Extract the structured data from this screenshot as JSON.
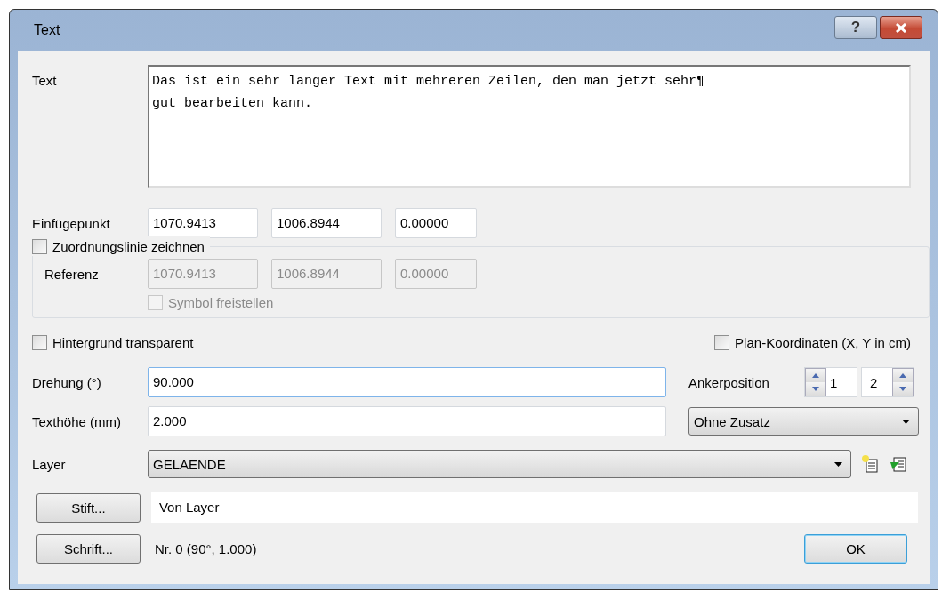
{
  "window": {
    "title": "Text",
    "help_button": "?"
  },
  "text": {
    "label": "Text",
    "value": "Das ist ein sehr langer Text mit mehreren Zeilen, den man jetzt sehr¶\ngut bearbeiten kann."
  },
  "insertion_point": {
    "label": "Einfügepunkt",
    "values": [
      "1070.9413",
      "1006.8944",
      "0.00000"
    ]
  },
  "leader_line": {
    "label": "Zuordnungslinie zeichnen",
    "checked": false,
    "reference_label": "Referenz",
    "reference_values": [
      "1070.9413",
      "1006.8944",
      "0.00000"
    ],
    "symbol": {
      "label": "Symbol freistellen",
      "checked": false,
      "disabled": true
    }
  },
  "transparent_background": {
    "label": "Hintergrund transparent",
    "checked": false
  },
  "plan_coordinates": {
    "label": "Plan-Koordinaten (X, Y in cm)",
    "checked": false
  },
  "rotation": {
    "label": "Drehung (°)",
    "value": "90.000"
  },
  "text_height": {
    "label": "Texthöhe (mm)",
    "value": "2.000"
  },
  "anchor": {
    "label": "Ankerposition",
    "values": [
      "1",
      "2"
    ]
  },
  "addition": {
    "value": "Ohne Zusatz"
  },
  "layer": {
    "label": "Layer",
    "value": "GELAENDE"
  },
  "pen": {
    "button": "Stift...",
    "value": "Von Layer"
  },
  "font": {
    "button": "Schrift...",
    "value": "Nr. 0 (90°, 1.000)"
  },
  "ok_button": "OK"
}
